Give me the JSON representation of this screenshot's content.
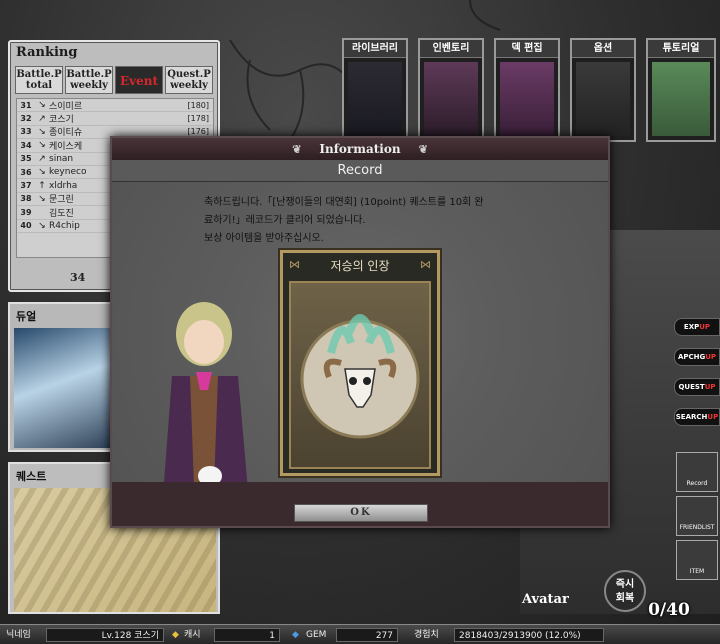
{
  "ranking": {
    "title": "Ranking",
    "tabs": [
      {
        "line1": "Battle.P",
        "line2": "total"
      },
      {
        "line1": "Battle.P",
        "line2": "weekly"
      },
      {
        "line1": "Event",
        "line2": ""
      },
      {
        "line1": "Quest.P",
        "line2": "weekly"
      }
    ],
    "rows": [
      {
        "num": "31",
        "arrow": "↘",
        "name": "스이미르",
        "pts": "[180]"
      },
      {
        "num": "32",
        "arrow": "↗",
        "name": "코스기",
        "pts": "[178]"
      },
      {
        "num": "33",
        "arrow": "↘",
        "name": "종이티슈",
        "pts": "[176]"
      },
      {
        "num": "34",
        "arrow": "↘",
        "name": "케이스케",
        "pts": ""
      },
      {
        "num": "35",
        "arrow": "↗",
        "name": "sinan",
        "pts": ""
      },
      {
        "num": "36",
        "arrow": "↘",
        "name": "keyneco",
        "pts": ""
      },
      {
        "num": "37",
        "arrow": "↑",
        "name": "xldrha",
        "pts": ""
      },
      {
        "num": "38",
        "arrow": "↘",
        "name": "문그린",
        "pts": ""
      },
      {
        "num": "39",
        "arrow": "",
        "name": "김도진",
        "pts": ""
      },
      {
        "num": "40",
        "arrow": "↘",
        "name": "R4chip",
        "pts": ""
      }
    ],
    "page": "34"
  },
  "duel": {
    "label": "듀얼"
  },
  "quest": {
    "label": "퀘스트"
  },
  "top_menu": [
    "라이브러리",
    "인벤토리",
    "덱 편집",
    "옵션",
    "튜토리얼"
  ],
  "side_buttons": [
    {
      "main": "EXP",
      "up": "UP"
    },
    {
      "main": "APCHG",
      "up": "UP"
    },
    {
      "main": "QUEST",
      "up": "UP"
    },
    {
      "main": "SEARCH",
      "up": "UP"
    }
  ],
  "icon_buttons": [
    "Record",
    "FRIENDLIST",
    "ITEM"
  ],
  "avatar_label": "Avatar",
  "instant_heal": {
    "line1": "즉시",
    "line2": "회복"
  },
  "ap": "0/40",
  "bottom": {
    "nickname_label": "닉네임",
    "level_name": "Lv.128 코스기",
    "cash_label": "캐시",
    "cash_value": "1",
    "gem_label": "GEM",
    "gem_value": "277",
    "exp_label": "경험치",
    "exp_value": "2818403/2913900 (12.0%)"
  },
  "dialog": {
    "header": "Information",
    "subtitle": "Record",
    "message_line1": "축하드립니다.「[난쟁이들의 대연회] (10point) 퀘스트를 10회 완",
    "message_line2": "료하기!」레코드가 클리어 되었습니다.",
    "message_line3": "보상 아이템을 받아주십시오.",
    "reward_title": "저승의 인장",
    "ok_label": "OK"
  },
  "colors": {
    "event_tab": "#d6282c",
    "dialog_frame": "#3a2a2d",
    "card_border": "#b49a62"
  }
}
